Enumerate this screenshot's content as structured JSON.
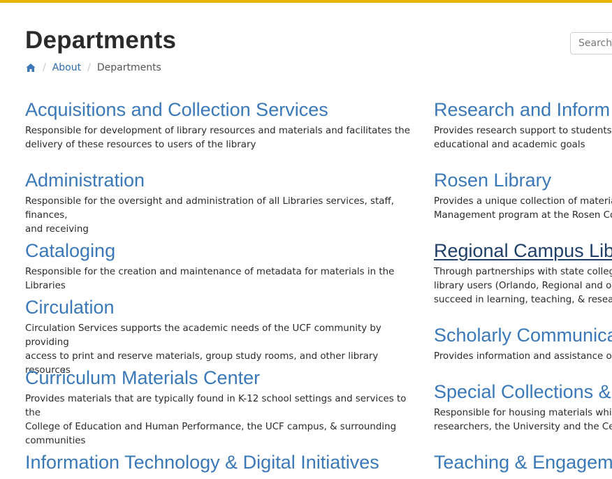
{
  "page": {
    "title": "Departments",
    "search_placeholder": "Search"
  },
  "breadcrumb": {
    "home_icon": "home-icon",
    "items": [
      "About",
      "Departments"
    ]
  },
  "colors": {
    "top_bar": "#e7b50a",
    "link": "#3a78b8",
    "active_link": "#1f3f66"
  },
  "left_departments": [
    {
      "name": "Acquisitions and Collection Services",
      "description": "Responsible for development of library resources and materials and facilitates the\ndelivery of these resources to users of the library"
    },
    {
      "name": "Administration",
      "description": "Responsible for the oversight and administration of all Libraries services, staff, finances,\nand receiving"
    },
    {
      "name": "Cataloging",
      "description": "Responsible for the creation and maintenance of metadata for materials in the Libraries"
    },
    {
      "name": "Circulation",
      "description": "Circulation Services supports the academic needs of the UCF community by providing\naccess to print and reserve materials, group study rooms, and other library resources"
    },
    {
      "name": "Curriculum Materials Center",
      "description": "Provides materials that are typically found in K-12 school settings and services to the\nCollege of Education and Human Performance, the UCF campus, & surrounding\ncommunities"
    },
    {
      "name": "Information Technology & Digital Initiatives",
      "description": ""
    }
  ],
  "right_departments": [
    {
      "name": "Research and Inform",
      "description": "Provides research support to students ar\neducational and academic goals"
    },
    {
      "name": "Rosen Library",
      "description": "Provides a unique collection of materials\nManagement program at the Rosen Colle"
    },
    {
      "name": "Regional Campus Lib",
      "description": "Through partnerships with state college l\nlibrary users (Orlando, Regional and onlin\nsucceed in learning, teaching, & research"
    },
    {
      "name": "Scholarly Communica",
      "description": "Provides information and assistance on a"
    },
    {
      "name": "Special Collections &",
      "description": "Responsible for housing materials which\nresearchers, the University and the Centr"
    },
    {
      "name": "Teaching & Engagem",
      "description": ""
    }
  ]
}
